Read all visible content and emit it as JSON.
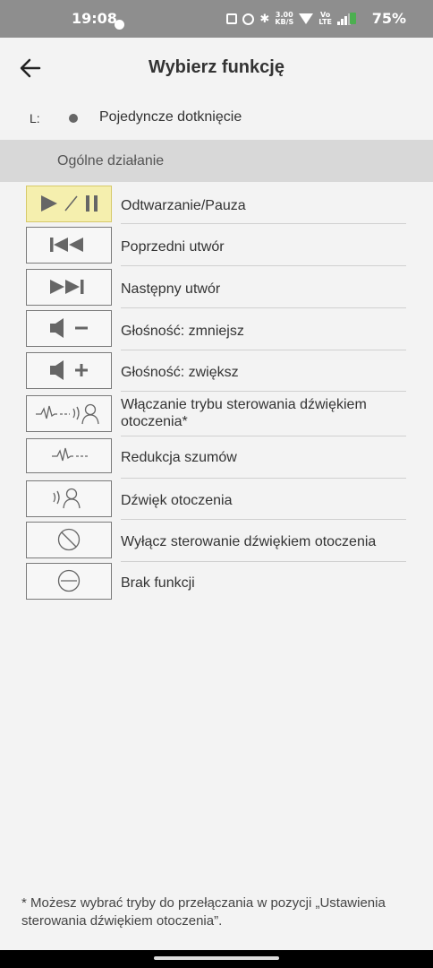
{
  "status_bar": {
    "time": "19:08",
    "speed_top": "3.00",
    "speed_bottom": "KB/S",
    "volte_top": "Vo",
    "volte_bottom": "LTE",
    "battery": "75%"
  },
  "header": {
    "title": "Wybierz funkcję",
    "back_icon": "arrow-left-icon"
  },
  "mode_row": {
    "side": "L:",
    "label": "Pojedyncze dotknięcie"
  },
  "section": {
    "title": "Ogólne działanie"
  },
  "items": [
    {
      "label": "Odtwarzanie/Pauza",
      "icon": "play-pause-icon",
      "selected": true
    },
    {
      "label": "Poprzedni utwór",
      "icon": "previous-track-icon",
      "selected": false
    },
    {
      "label": "Następny utwór",
      "icon": "next-track-icon",
      "selected": false
    },
    {
      "label": "Głośność: zmniejsz",
      "icon": "volume-down-icon",
      "selected": false
    },
    {
      "label": "Głośność: zwiększ",
      "icon": "volume-up-icon",
      "selected": false
    },
    {
      "label": "Włączanie trybu sterowania dźwiękiem otoczenia*",
      "icon": "ambient-sound-toggle-icon",
      "selected": false
    },
    {
      "label": "Redukcja szumów",
      "icon": "noise-cancelling-icon",
      "selected": false
    },
    {
      "label": "Dźwięk otoczenia",
      "icon": "ambient-sound-icon",
      "selected": false
    },
    {
      "label": "Wyłącz sterowanie dźwiękiem otoczenia",
      "icon": "ambient-off-icon",
      "selected": false
    },
    {
      "label": "Brak funkcji",
      "icon": "no-function-icon",
      "selected": false
    }
  ],
  "footnote": "* Możesz wybrać tryby do przełączania w pozycji „Ustawienia sterowania dźwiękiem otoczenia”.",
  "colors": {
    "selected_bg": "#f5efae",
    "section_bg": "#d8d8d8",
    "status_bar_bg": "#8e8e8e"
  }
}
